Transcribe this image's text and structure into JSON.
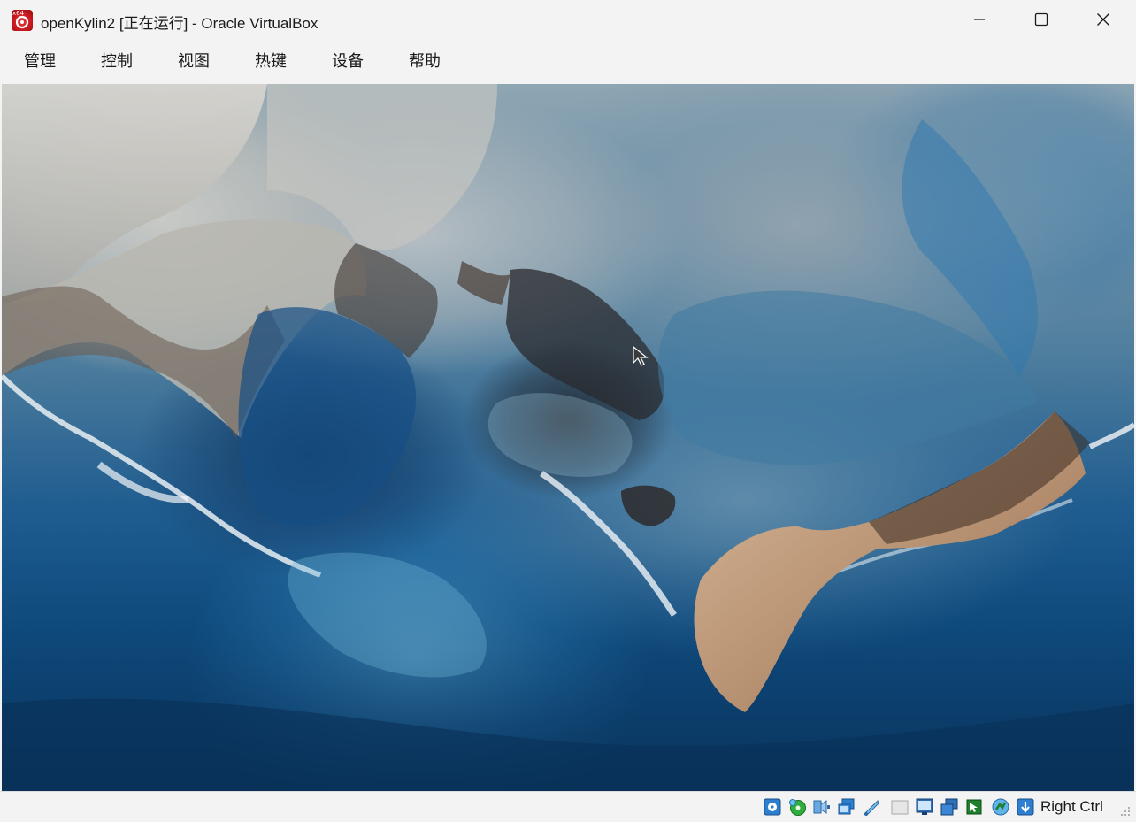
{
  "window": {
    "title": "openKylin2 [正在运行] - Oracle VirtualBox",
    "app_icon": "virtualbox-vm-icon",
    "app_icon_badge": "x64"
  },
  "menu": {
    "items": [
      {
        "label": "管理"
      },
      {
        "label": "控制"
      },
      {
        "label": "视图"
      },
      {
        "label": "热键"
      },
      {
        "label": "设备"
      },
      {
        "label": "帮助"
      }
    ]
  },
  "statusbar": {
    "icons": [
      "hard-disk-icon",
      "optical-drive-icon",
      "audio-icon",
      "network-icon",
      "usb-icon",
      "shared-folders-icon",
      "display-icon",
      "recording-icon",
      "mouse-integration-icon",
      "cpu-activity-icon",
      "keyboard-capture-icon"
    ],
    "host_key": "Right Ctrl"
  },
  "colors": {
    "chrome_bg": "#f3f3f3",
    "text": "#1a1a1a",
    "vbox_blue": "#1f6fc5"
  }
}
